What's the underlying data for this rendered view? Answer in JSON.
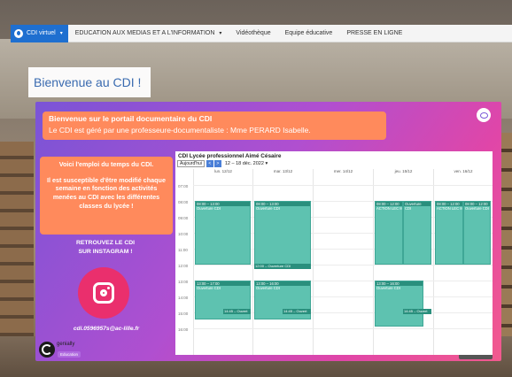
{
  "nav": {
    "items": [
      {
        "label": "CDI virtuel",
        "caret": "▾",
        "active": true
      },
      {
        "label": "EDUCATION AUX MEDIAS ET A L'INFORMATION",
        "caret": "▾",
        "active": false
      },
      {
        "label": "Vidéothèque",
        "caret": "",
        "active": false
      },
      {
        "label": "Equipe éducative",
        "caret": "",
        "active": false
      },
      {
        "label": "PRESSE EN LIGNE",
        "caret": "",
        "active": false
      }
    ]
  },
  "page": {
    "title": "Bienvenue au CDI !"
  },
  "welcome": {
    "line1": "Bienvenue sur le portail documentaire du CDI",
    "line2": "Le CDI est géré par une professeure-documentaliste : Mme PERARD Isabelle."
  },
  "info": {
    "p1": "Voici l'emploi du temps du CDI.",
    "p2": "Il est susceptible d'être modifié chaque semaine en fonction des activités menées au CDI avec les différentes classes du lycée !"
  },
  "instagram": {
    "line1": "RETROUVEZ LE CDI",
    "line2": "SUR INSTAGRAM !",
    "icon": "instagram-icon"
  },
  "email": "cdi.0596957s@ac-lille.fr",
  "genially": {
    "name": "genially",
    "badge": "Education"
  },
  "share": {
    "share_glyph": "<",
    "fullscreen_glyph": "⛶"
  },
  "calendar": {
    "title": "CDI Lycée professionnel Aimé Césaire",
    "view_button": "Aujourd'hui",
    "prev": "<",
    "next": ">",
    "range": "12 – 18 déc. 2022",
    "range_caret": "▾",
    "days": [
      "lun. 12/12",
      "mar. 13/12",
      "mer. 14/12",
      "jeu. 15/12",
      "ven. 16/12"
    ],
    "hours": [
      "07:00",
      "08:00",
      "09:00",
      "10:00",
      "11:00",
      "12:00",
      "13:00",
      "14:00",
      "15:00",
      "16:00"
    ],
    "events": {
      "mon_am": {
        "time": "08:00 – 13:00",
        "name": "Ouverture CDI"
      },
      "mon_pm": {
        "time": "13:00 – 17:00",
        "name": "Ouverture CDI"
      },
      "mon_pm_strip": "14:45 – Ouvert",
      "tue_am": {
        "time": "08:00 – 13:00",
        "name": "Ouverture CDI"
      },
      "tue_noon_strip": "12:00 – Ouverture CDI",
      "tue_pm": {
        "time": "13:00 – 16:00",
        "name": "Ouverture CDI"
      },
      "tue_pm_strip": "14:45 – Ouvert",
      "thu_am_a": {
        "time": "08:00 – 12:00",
        "name": "ACTION LEC Maternelle"
      },
      "thu_am_b": {
        "time": "Ouverture",
        "name": "CDI"
      },
      "thu_pm": {
        "time": "13:00 – 16:00",
        "name": "Ouverture CDI"
      },
      "thu_pm_strip": "14:45 – Ouvert",
      "fri_am_a": {
        "time": "08:00 – 12:00",
        "name": "ACTION LEC MATERNELLE"
      },
      "fri_am_b": {
        "time": "08:00 – 12:00",
        "name": "Ouverture CDI"
      }
    }
  }
}
